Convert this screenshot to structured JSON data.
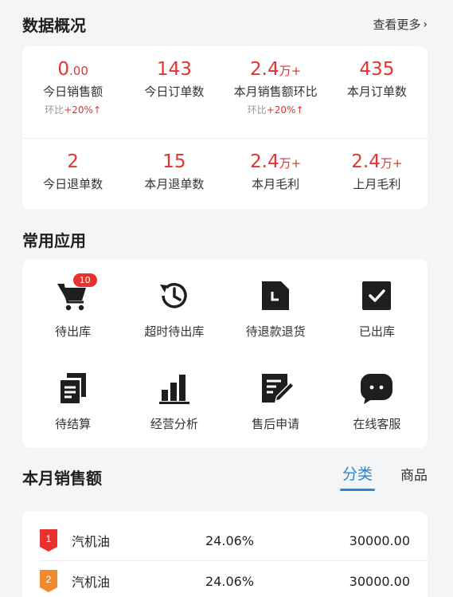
{
  "overview": {
    "title": "数据概况",
    "more_link": "查看更多",
    "stats_row1": [
      {
        "value": "0",
        "suffix": ".00",
        "label": "今日销售额",
        "sub_prefix": "环比",
        "sub_pct": "+20%",
        "sub_arrow": "↑"
      },
      {
        "value": "143",
        "suffix": "",
        "label": "今日订单数"
      },
      {
        "value": "2.4",
        "suffix": "万+",
        "label": "本月销售额环比",
        "sub_prefix": "环比",
        "sub_pct": "+20%",
        "sub_arrow": "↑"
      },
      {
        "value": "435",
        "suffix": "",
        "label": "本月订单数"
      }
    ],
    "stats_row2": [
      {
        "value": "2",
        "suffix": "",
        "label": "今日退单数"
      },
      {
        "value": "15",
        "suffix": "",
        "label": "本月退单数"
      },
      {
        "value": "2.4",
        "suffix": "万+",
        "label": "本月毛利"
      },
      {
        "value": "2.4",
        "suffix": "万+",
        "label": "上月毛利"
      }
    ]
  },
  "apps": {
    "title": "常用应用",
    "row1": [
      {
        "label": "待出库",
        "icon": "cart-icon",
        "badge": "10"
      },
      {
        "label": "超时待出库",
        "icon": "history-clock-icon"
      },
      {
        "label": "待退款退货",
        "icon": "document-icon"
      },
      {
        "label": "已出库",
        "icon": "checkbox-icon"
      }
    ],
    "row2": [
      {
        "label": "待结算",
        "icon": "copy-documents-icon"
      },
      {
        "label": "经营分析",
        "icon": "bar-chart-icon"
      },
      {
        "label": "售后申请",
        "icon": "edit-note-icon"
      },
      {
        "label": "在线客服",
        "icon": "chat-bubble-icon"
      }
    ]
  },
  "monthly_sales": {
    "title": "本月销售额",
    "tabs": [
      "分类",
      "商品"
    ],
    "active_tab": "分类",
    "rankings": [
      {
        "rank": "1",
        "name": "汽机油",
        "percent": "24.06%",
        "amount": "30000.00",
        "color": "#e8322f"
      },
      {
        "rank": "2",
        "name": "汽机油",
        "percent": "24.06%",
        "amount": "30000.00",
        "color": "#f08a2c"
      }
    ]
  },
  "colors": {
    "accent_red": "#e8322f",
    "accent_blue": "#2a86d8",
    "rank2_orange": "#f08a2c"
  }
}
